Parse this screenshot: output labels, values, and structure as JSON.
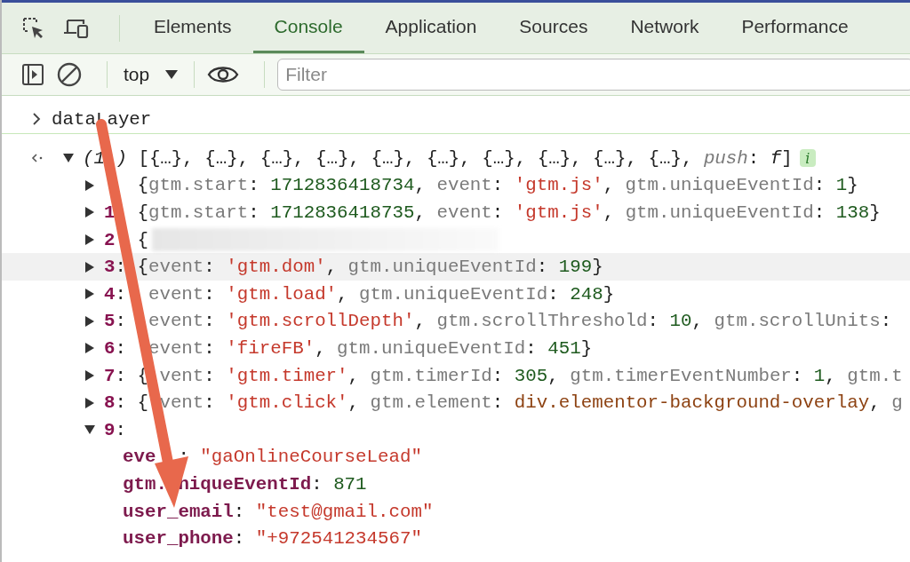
{
  "tabs": [
    {
      "label": "Elements",
      "selected": false
    },
    {
      "label": "Console",
      "selected": true
    },
    {
      "label": "Application",
      "selected": false
    },
    {
      "label": "Sources",
      "selected": false
    },
    {
      "label": "Network",
      "selected": false
    },
    {
      "label": "Performance",
      "selected": false
    }
  ],
  "console_toolbar": {
    "context": "top",
    "filter_placeholder": "Filter"
  },
  "input": {
    "command": "dataLayer"
  },
  "result": {
    "expanded": true,
    "tokens": [
      {
        "kind": "len",
        "text": "(1"
      },
      {
        "kind": "hid"
      },
      {
        "kind": "len",
        "text": ")"
      },
      {
        "kind": "plain",
        "text": " [{…}, {…}, {…}, {…}, {…}, {…}, {…}, {…}, {…}, {…}, "
      },
      {
        "kind": "ikey",
        "text": "push"
      },
      {
        "kind": "plain",
        "text": ": "
      },
      {
        "kind": "ital",
        "text": "f"
      },
      {
        "kind": "plain",
        "text": "]"
      }
    ],
    "info_badge": "i"
  },
  "entries": [
    {
      "expanded": false,
      "highlighted": false,
      "tokens": [
        {
          "kind": "hid"
        },
        {
          "kind": "hid"
        },
        {
          "kind": "plain",
          "text": " {"
        },
        {
          "kind": "key",
          "text": "gtm.start"
        },
        {
          "kind": "plain",
          "text": ": "
        },
        {
          "kind": "num",
          "text": "1712836418734"
        },
        {
          "kind": "plain",
          "text": ", "
        },
        {
          "kind": "key",
          "text": "event"
        },
        {
          "kind": "plain",
          "text": ": "
        },
        {
          "kind": "str",
          "text": "'gtm.js'"
        },
        {
          "kind": "plain",
          "text": ", "
        },
        {
          "kind": "key",
          "text": "gtm.uniqueEventId"
        },
        {
          "kind": "plain",
          "text": ": "
        },
        {
          "kind": "num",
          "text": "1"
        },
        {
          "kind": "plain",
          "text": "}"
        }
      ]
    },
    {
      "expanded": false,
      "highlighted": false,
      "tokens": [
        {
          "kind": "idx",
          "text": "1"
        },
        {
          "kind": "hid"
        },
        {
          "kind": "plain",
          "text": " {"
        },
        {
          "kind": "key",
          "text": "gtm.start"
        },
        {
          "kind": "plain",
          "text": ": "
        },
        {
          "kind": "num",
          "text": "1712836418735"
        },
        {
          "kind": "plain",
          "text": ", "
        },
        {
          "kind": "key",
          "text": "event"
        },
        {
          "kind": "plain",
          "text": ": "
        },
        {
          "kind": "str",
          "text": "'gtm.js'"
        },
        {
          "kind": "plain",
          "text": ", "
        },
        {
          "kind": "key",
          "text": "gtm.uniqueEventId"
        },
        {
          "kind": "plain",
          "text": ": "
        },
        {
          "kind": "num",
          "text": "138"
        },
        {
          "kind": "plain",
          "text": "}"
        }
      ]
    },
    {
      "expanded": false,
      "highlighted": false,
      "tokens": [
        {
          "kind": "idx",
          "text": "2"
        },
        {
          "kind": "hid"
        },
        {
          "kind": "plain",
          "text": " {"
        },
        {
          "kind": "blur"
        }
      ]
    },
    {
      "expanded": false,
      "highlighted": true,
      "tokens": [
        {
          "kind": "idx",
          "text": "3"
        },
        {
          "kind": "plain",
          "text": ": {"
        },
        {
          "kind": "key",
          "text": "event"
        },
        {
          "kind": "plain",
          "text": ": "
        },
        {
          "kind": "str",
          "text": "'gtm.dom'"
        },
        {
          "kind": "plain",
          "text": ", "
        },
        {
          "kind": "key",
          "text": "gtm.uniqueEventId"
        },
        {
          "kind": "plain",
          "text": ": "
        },
        {
          "kind": "num",
          "text": "199"
        },
        {
          "kind": "plain",
          "text": "}"
        }
      ]
    },
    {
      "expanded": false,
      "highlighted": false,
      "tokens": [
        {
          "kind": "idx",
          "text": "4"
        },
        {
          "kind": "plain",
          "text": ": "
        },
        {
          "kind": "hid"
        },
        {
          "kind": "key",
          "text": "event"
        },
        {
          "kind": "plain",
          "text": ": "
        },
        {
          "kind": "str",
          "text": "'gtm.load'"
        },
        {
          "kind": "plain",
          "text": ", "
        },
        {
          "kind": "key",
          "text": "gtm.uniqueEventId"
        },
        {
          "kind": "plain",
          "text": ": "
        },
        {
          "kind": "num",
          "text": "248"
        },
        {
          "kind": "plain",
          "text": "}"
        }
      ]
    },
    {
      "expanded": false,
      "highlighted": false,
      "tokens": [
        {
          "kind": "idx",
          "text": "5"
        },
        {
          "kind": "plain",
          "text": ": "
        },
        {
          "kind": "hid"
        },
        {
          "kind": "key",
          "text": "event"
        },
        {
          "kind": "plain",
          "text": ": "
        },
        {
          "kind": "str",
          "text": "'gtm.scrollDepth'"
        },
        {
          "kind": "plain",
          "text": ", "
        },
        {
          "kind": "key",
          "text": "gtm.scrollThreshold"
        },
        {
          "kind": "plain",
          "text": ": "
        },
        {
          "kind": "num",
          "text": "10"
        },
        {
          "kind": "plain",
          "text": ", "
        },
        {
          "kind": "key",
          "text": "gtm.scrollUnits"
        },
        {
          "kind": "plain",
          "text": ":"
        }
      ]
    },
    {
      "expanded": false,
      "highlighted": false,
      "tokens": [
        {
          "kind": "idx",
          "text": "6"
        },
        {
          "kind": "plain",
          "text": ": "
        },
        {
          "kind": "hid"
        },
        {
          "kind": "key",
          "text": "event"
        },
        {
          "kind": "plain",
          "text": ": "
        },
        {
          "kind": "str",
          "text": "'fireFB'"
        },
        {
          "kind": "plain",
          "text": ", "
        },
        {
          "kind": "key",
          "text": "gtm.uniqueEventId"
        },
        {
          "kind": "plain",
          "text": ": "
        },
        {
          "kind": "num",
          "text": "451"
        },
        {
          "kind": "plain",
          "text": "}"
        }
      ]
    },
    {
      "expanded": false,
      "highlighted": false,
      "tokens": [
        {
          "kind": "idx",
          "text": "7"
        },
        {
          "kind": "plain",
          "text": ": {"
        },
        {
          "kind": "hid"
        },
        {
          "kind": "key",
          "text": "vent"
        },
        {
          "kind": "plain",
          "text": ": "
        },
        {
          "kind": "str",
          "text": "'gtm.timer'"
        },
        {
          "kind": "plain",
          "text": ", "
        },
        {
          "kind": "key",
          "text": "gtm.timerId"
        },
        {
          "kind": "plain",
          "text": ": "
        },
        {
          "kind": "num",
          "text": "305"
        },
        {
          "kind": "plain",
          "text": ", "
        },
        {
          "kind": "key",
          "text": "gtm.timerEventNumber"
        },
        {
          "kind": "plain",
          "text": ": "
        },
        {
          "kind": "num",
          "text": "1"
        },
        {
          "kind": "plain",
          "text": ", "
        },
        {
          "kind": "key",
          "text": "gtm.t"
        }
      ]
    },
    {
      "expanded": false,
      "highlighted": false,
      "tokens": [
        {
          "kind": "idx",
          "text": "8"
        },
        {
          "kind": "plain",
          "text": ": {"
        },
        {
          "kind": "hid"
        },
        {
          "kind": "key",
          "text": "vent"
        },
        {
          "kind": "plain",
          "text": ": "
        },
        {
          "kind": "str",
          "text": "'gtm.click'"
        },
        {
          "kind": "plain",
          "text": ", "
        },
        {
          "kind": "key",
          "text": "gtm.element"
        },
        {
          "kind": "plain",
          "text": ": "
        },
        {
          "kind": "obj",
          "text": "div.elementor-background-overlay"
        },
        {
          "kind": "plain",
          "text": ", "
        },
        {
          "kind": "key",
          "text": "g"
        }
      ]
    },
    {
      "expanded": true,
      "highlighted": false,
      "tokens": [
        {
          "kind": "idx",
          "text": "9"
        },
        {
          "kind": "plain",
          "text": ":"
        }
      ],
      "children": [
        {
          "tokens": [
            {
              "kind": "pkey",
              "text": "eve"
            },
            {
              "kind": "hid"
            },
            {
              "kind": "hid"
            },
            {
              "kind": "plain",
              "text": ": "
            },
            {
              "kind": "str",
              "text": "\"gaOnlineCourseLead\""
            }
          ]
        },
        {
          "tokens": [
            {
              "kind": "pkey",
              "text": "gtm."
            },
            {
              "kind": "hid"
            },
            {
              "kind": "pkey",
              "text": "niqueEventId"
            },
            {
              "kind": "plain",
              "text": ": "
            },
            {
              "kind": "num",
              "text": "871"
            }
          ]
        },
        {
          "tokens": [
            {
              "kind": "pkey",
              "text": "user_email"
            },
            {
              "kind": "plain",
              "text": ": "
            },
            {
              "kind": "str",
              "text": "\"test@gmail.com\""
            }
          ]
        },
        {
          "tokens": [
            {
              "kind": "pkey",
              "text": "user_phone"
            },
            {
              "kind": "plain",
              "text": ": "
            },
            {
              "kind": "str",
              "text": "\"+972541234567\""
            }
          ]
        }
      ]
    }
  ]
}
